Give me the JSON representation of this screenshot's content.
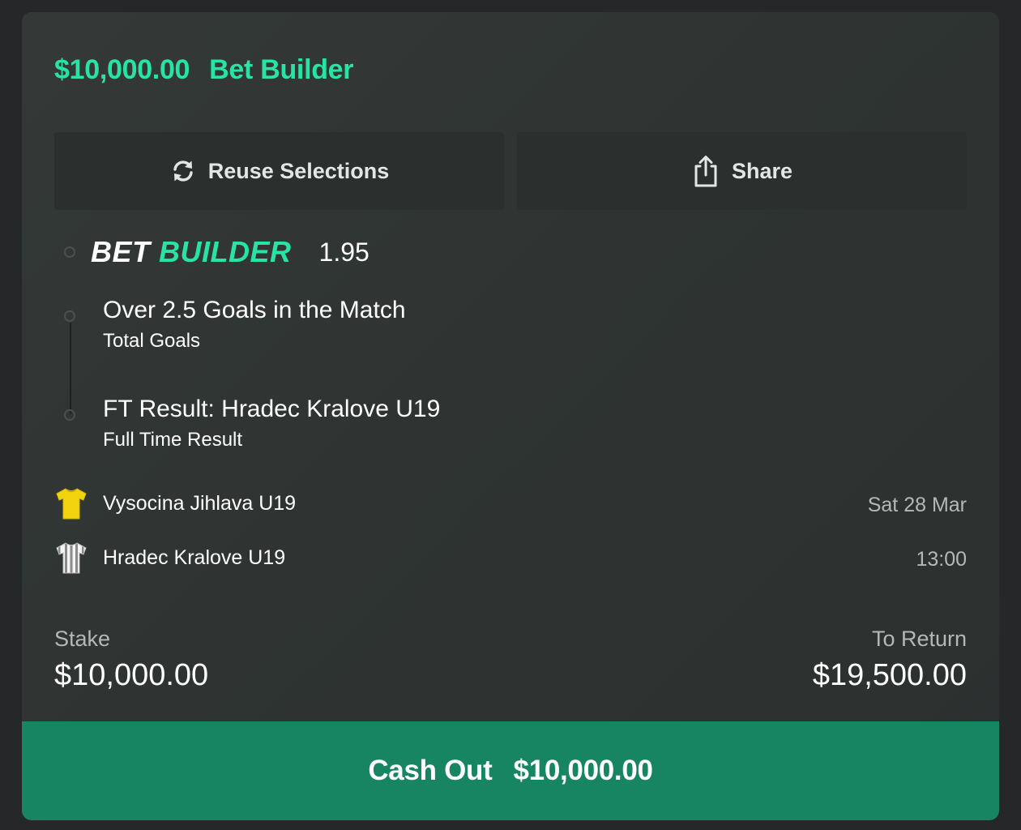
{
  "header": {
    "stake_amount": "$10,000.00",
    "bet_type": "Bet Builder"
  },
  "actions": {
    "reuse_label": "Reuse Selections",
    "share_label": "Share"
  },
  "bet_builder": {
    "logo_word1": "BET",
    "logo_word2": "BUILDER",
    "odds": "1.95",
    "selections": [
      {
        "title": "Over 2.5 Goals in the Match",
        "market": "Total Goals"
      },
      {
        "title": "FT Result: Hradec Kralove U19",
        "market": "Full Time Result"
      }
    ]
  },
  "event": {
    "home_team": "Vysocina Jihlava U19",
    "away_team": "Hradec Kralove U19",
    "date": "Sat 28 Mar",
    "time": "13:00",
    "home_kit_icon": "yellow-shirt-icon",
    "away_kit_icon": "striped-shirt-icon"
  },
  "totals": {
    "stake_label": "Stake",
    "stake_value": "$10,000.00",
    "return_label": "To Return",
    "return_value": "$19,500.00"
  },
  "cashout": {
    "label": "Cash Out",
    "amount": "$10,000.00"
  },
  "colors": {
    "accent": "#27e4a4",
    "cashout_bg": "#178462",
    "card_bg": "#343937"
  }
}
